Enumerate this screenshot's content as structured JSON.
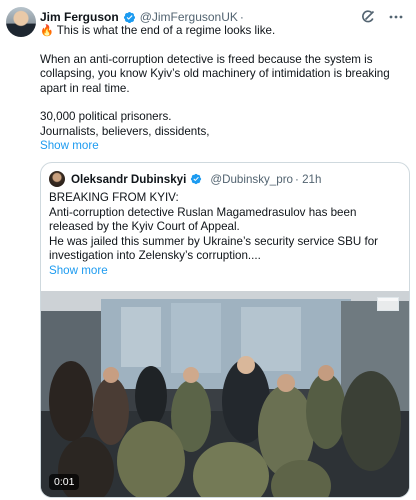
{
  "post": {
    "author_name": "Jim Ferguson",
    "author_handle": "@JimFergusonUK",
    "separator": "·",
    "lines": [
      "This is what the end of a regime looks like.",
      "When an anti-corruption detective is freed because the system is collapsing, you know Kyiv’s old machinery of intimidation is breaking apart in real time.",
      "30,000 political prisoners.",
      "Journalists, believers, dissidents,"
    ],
    "fire_emoji": "🔥",
    "show_more": "Show more"
  },
  "quote": {
    "author_name": "Oleksandr Dubinskyi",
    "author_handle": "@Dubinsky_pro",
    "time": "· 21h",
    "lines": [
      "BREAKING FROM KYIV:",
      "Anti-corruption detective Ruslan Magamedrasulov has been released by the Kyiv Court of Appeal.",
      "He was jailed this summer by Ukraine’s security service SBU for investigation into Zelensky’s corruption...."
    ],
    "show_more": "Show more",
    "video": {
      "timecode": "0:01"
    }
  },
  "colors": {
    "accent": "#1d9bf0",
    "verified": "#1d9bf0",
    "text": "#0f1419",
    "muted": "#536471",
    "border": "#cfd9de"
  },
  "icons": [
    "verified-badge-icon",
    "grok-icon",
    "more-icon",
    "fire-icon"
  ]
}
